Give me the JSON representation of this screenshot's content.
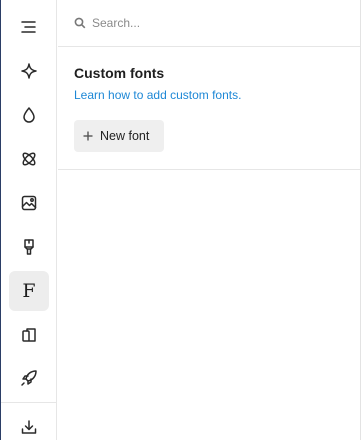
{
  "sidebar": {
    "items": [
      {
        "name": "menu-icon",
        "active": false
      },
      {
        "name": "sparkle-icon",
        "active": false
      },
      {
        "name": "drop-icon",
        "active": false
      },
      {
        "name": "atom-icon",
        "active": false
      },
      {
        "name": "image-icon",
        "active": false
      },
      {
        "name": "brush-icon",
        "active": false
      },
      {
        "name": "font-icon",
        "glyph": "F",
        "active": true
      },
      {
        "name": "layout-icon",
        "active": false
      },
      {
        "name": "rocket-icon",
        "active": false
      },
      {
        "name": "download-icon",
        "active": false
      }
    ]
  },
  "search": {
    "placeholder": "Search..."
  },
  "custom_fonts": {
    "title": "Custom fonts",
    "help_link": "Learn how to add custom fonts.",
    "new_font_label": "New font"
  },
  "colors": {
    "accent_link": "#1e88d6",
    "active_bg": "#ededed",
    "frame_left": "#2b3e66"
  }
}
